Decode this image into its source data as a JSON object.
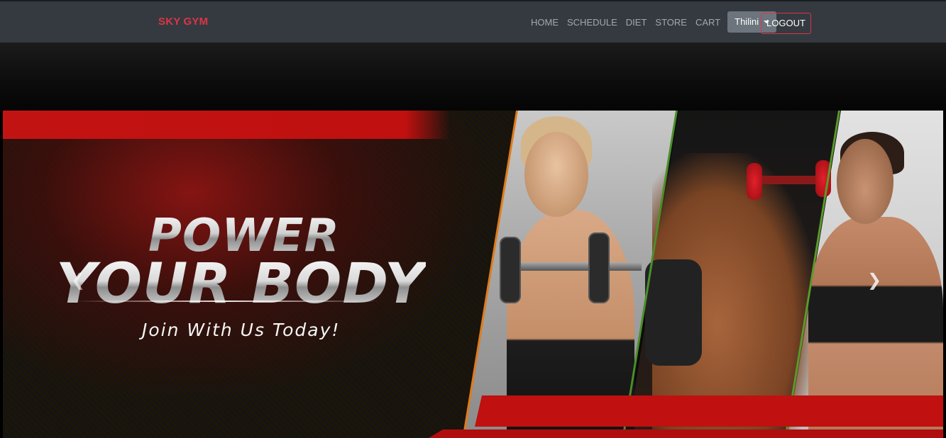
{
  "brand": "SKY GYM",
  "nav": {
    "items": [
      "HOME",
      "SCHEDULE",
      "DIET",
      "STORE",
      "CART"
    ],
    "user": "Thilini",
    "logout_label": "LOGOUT"
  },
  "hero": {
    "headline_line1": "POWER",
    "headline_line2": "YOUR BODY",
    "tagline": "Join With Us Today!",
    "prev_icon": "chevron-left",
    "next_icon": "chevron-right"
  },
  "colors": {
    "navbar_bg": "#343a40",
    "brand": "#dc3545",
    "accent_red": "#c01010",
    "user_dropdown_bg": "#6c757d"
  }
}
